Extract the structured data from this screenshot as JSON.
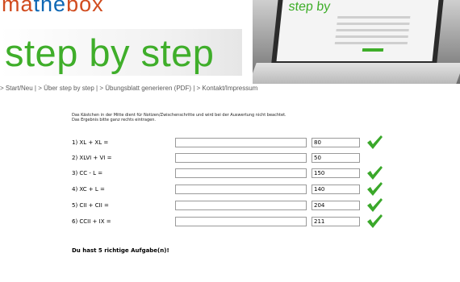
{
  "header": {
    "logo_ma": "ma",
    "logo_the": "the",
    "logo_box": "box",
    "tagline": "step by step",
    "laptop_screen_title": "step by"
  },
  "nav": {
    "items": [
      "> Start/Neu |",
      "> Über step by step |",
      "> Übungsblatt generieren (PDF) |",
      "> Kontakt/Impressum"
    ]
  },
  "intro": {
    "line1": "Das Kästchen in der Mitte dient für Notizen/Zwischenschritte und wird bei der Auswertung nicht beachtet.",
    "line2": "Das Ergebnis bitte ganz rechts eintragen."
  },
  "tasks": [
    {
      "label": "1) XL + XL =",
      "notes": "",
      "answer": "80",
      "correct": true
    },
    {
      "label": "2) XLVI + VI =",
      "notes": "",
      "answer": "50",
      "correct": false
    },
    {
      "label": "3) CC - L =",
      "notes": "",
      "answer": "150",
      "correct": true
    },
    {
      "label": "4) XC + L =",
      "notes": "",
      "answer": "140",
      "correct": true
    },
    {
      "label": "5) CII + CII =",
      "notes": "",
      "answer": "204",
      "correct": true
    },
    {
      "label": "6) CCII + IX =",
      "notes": "",
      "answer": "211",
      "correct": true
    }
  ],
  "result": "Du hast 5 richtige Aufgabe(n)!",
  "colors": {
    "accent_green": "#3fae2a",
    "logo_orange": "#d14c1f",
    "logo_blue": "#0e67b4",
    "check_green": "#3aa82a"
  },
  "icons": {
    "check": "checkmark-icon"
  }
}
